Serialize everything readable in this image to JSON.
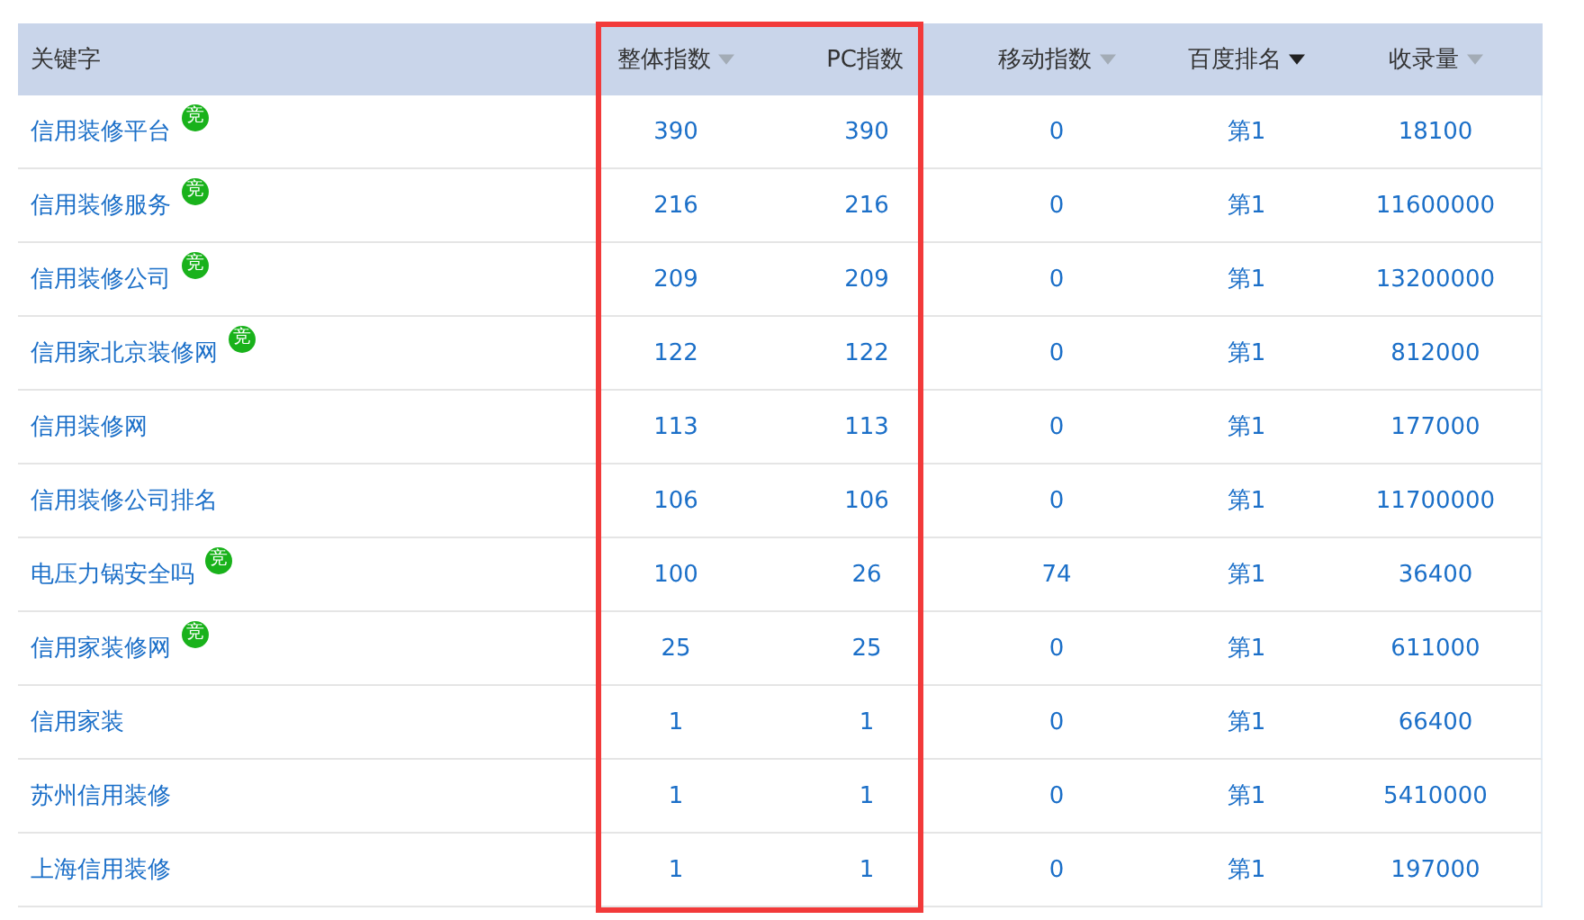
{
  "table": {
    "columns": [
      {
        "label": "关键字",
        "sort_arrow": false,
        "sorted": false,
        "highlighted": false
      },
      {
        "label": "整体指数",
        "sort_arrow": true,
        "sorted": false,
        "highlighted": true
      },
      {
        "label": "PC指数",
        "sort_arrow": false,
        "sorted": false,
        "highlighted": true
      },
      {
        "label": "移动指数",
        "sort_arrow": true,
        "sorted": false,
        "highlighted": false
      },
      {
        "label": "百度排名",
        "sort_arrow": true,
        "sorted": true,
        "highlighted": false
      },
      {
        "label": "收录量",
        "sort_arrow": true,
        "sorted": false,
        "highlighted": false
      }
    ],
    "rows": [
      {
        "badge": "竞",
        "cells": [
          "信用装修平台",
          "390",
          "390",
          "0",
          "第1",
          "18100"
        ]
      },
      {
        "badge": "竞",
        "cells": [
          "信用装修服务",
          "216",
          "216",
          "0",
          "第1",
          "11600000"
        ]
      },
      {
        "badge": "竞",
        "cells": [
          "信用装修公司",
          "209",
          "209",
          "0",
          "第1",
          "13200000"
        ]
      },
      {
        "badge": "竞",
        "cells": [
          "信用家北京装修网",
          "122",
          "122",
          "0",
          "第1",
          "812000"
        ]
      },
      {
        "cells": [
          "信用装修网",
          "113",
          "113",
          "0",
          "第1",
          "177000"
        ]
      },
      {
        "cells": [
          "信用装修公司排名",
          "106",
          "106",
          "0",
          "第1",
          "11700000"
        ]
      },
      {
        "badge": "竞",
        "cells": [
          "电压力锅安全吗",
          "100",
          "26",
          "74",
          "第1",
          "36400"
        ]
      },
      {
        "badge": "竞",
        "cells": [
          "信用家装修网",
          "25",
          "25",
          "0",
          "第1",
          "611000"
        ]
      },
      {
        "cells": [
          "信用家装",
          "1",
          "1",
          "0",
          "第1",
          "66400"
        ]
      },
      {
        "cells": [
          "苏州信用装修",
          "1",
          "1",
          "0",
          "第1",
          "5410000"
        ]
      },
      {
        "cells": [
          "上海信用装修",
          "1",
          "1",
          "0",
          "第1",
          "197000"
        ]
      }
    ]
  }
}
